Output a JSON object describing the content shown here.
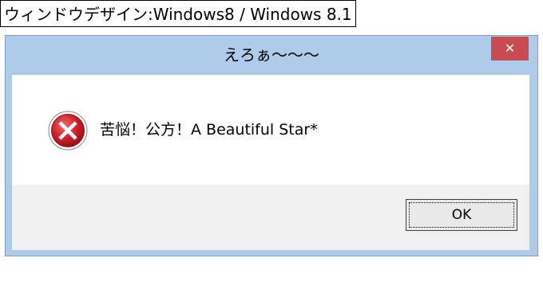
{
  "caption": {
    "text": "ウィンドウデザイン:Windows8 / Windows 8.1"
  },
  "dialog": {
    "title": "えろぁ〜〜〜",
    "close_label": "✕",
    "icon": "error-icon",
    "message": "苦悩！公方！A Beautiful Star*",
    "ok_label": "OK"
  },
  "colors": {
    "frame": "#aecbe9",
    "close_button": "#c74b50",
    "button_area": "#f0f0f0",
    "error_red": "#c8102e"
  }
}
